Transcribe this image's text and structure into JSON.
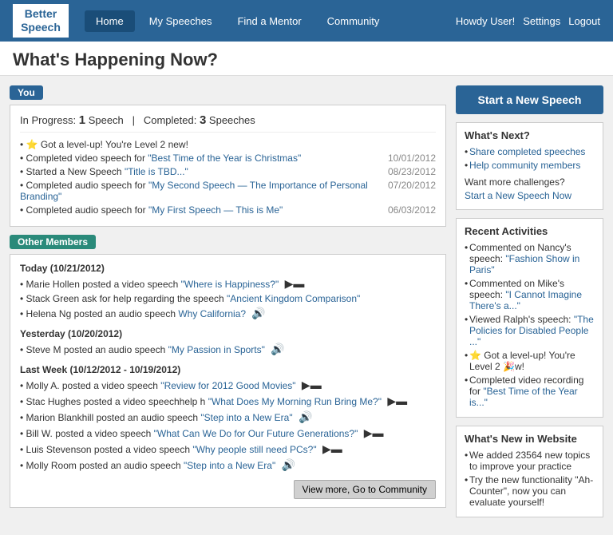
{
  "header": {
    "logo_line1": "Better",
    "logo_line2": "Speech",
    "nav_items": [
      {
        "label": "Home",
        "active": true
      },
      {
        "label": "My Speeches",
        "active": false
      },
      {
        "label": "Find a Mentor",
        "active": false
      },
      {
        "label": "Community",
        "active": false
      }
    ],
    "greeting": "Howdy User!",
    "settings_label": "Settings",
    "logout_label": "Logout"
  },
  "page": {
    "title": "What's Happening Now?",
    "start_button": "Start a New Speech"
  },
  "you_section": {
    "badge": "You",
    "in_progress_label": "In Progress:",
    "in_progress_count": "1",
    "in_progress_unit": "Speech",
    "separator": "|",
    "completed_label": "Completed:",
    "completed_count": "3",
    "completed_unit": "Speeches",
    "activities": [
      {
        "text": "⭐ Got a level-up! You're Level 2 new!",
        "link": null,
        "date": ""
      },
      {
        "prefix": "• Completed video speech for ",
        "link_text": "\"Best Time of the Year is Christmas\"",
        "link_href": "#",
        "date": "10/01/2012"
      },
      {
        "prefix": "• Started a New Speech ",
        "link_text": "\"Title is TBD...\"",
        "link_href": "#",
        "date": "08/23/2012"
      },
      {
        "prefix": "• Completed audio speech for ",
        "link_text": "\"My Second Speech — The Importance of Personal Branding\"",
        "link_href": "#",
        "date": "07/20/2012"
      },
      {
        "prefix": "• Completed audio speech for ",
        "link_text": "\"My First Speech — This is Me\"",
        "link_href": "#",
        "date": "06/03/2012"
      }
    ]
  },
  "other_section": {
    "badge": "Other Members",
    "days": [
      {
        "label": "Today (10/21/2012)",
        "items": [
          {
            "text": "• Marie Hollen posted a video speech ",
            "link_text": "\"Where is Happiness?\"",
            "link_href": "#",
            "icon": "video"
          },
          {
            "text": "• Stack Green ask for help regarding the speech ",
            "link_text": "\"Ancient Kingdom Comparison\"",
            "link_href": "#",
            "icon": null
          },
          {
            "text": "• Helena Ng posted an audio speech ",
            "link_text": "Why California?",
            "link_href": "#",
            "icon": "audio"
          }
        ]
      },
      {
        "label": "Yesterday (10/20/2012)",
        "items": [
          {
            "text": "• Steve M posted an audio speech ",
            "link_text": "\"My Passion in Sports\"",
            "link_href": "#",
            "icon": "audio"
          }
        ]
      },
      {
        "label": "Last Week (10/12/2012 - 10/19/2012)",
        "items": [
          {
            "text": "• Molly A. posted a video speech ",
            "link_text": "\"Review for 2012 Good Movies\"",
            "link_href": "#",
            "icon": "video"
          },
          {
            "text": "• Stac Hughes posted a video speechhelp h ",
            "link_text": "\"What Does My Morning Run Bring Me?\"",
            "link_href": "#",
            "icon": "video"
          },
          {
            "text": "• Marion Blankhill posted an audio speech ",
            "link_text": "\"Step into a New Era\"",
            "link_href": "#",
            "icon": "audio"
          },
          {
            "text": "• Bill W. posted a video speech ",
            "link_text": "\"What Can We Do for Our Future Generations?\"",
            "link_href": "#",
            "icon": "video"
          },
          {
            "text": "• Luis Stevenson posted a video speech ",
            "link_text": "\"Why people still need PCs?\"",
            "link_href": "#",
            "icon": "video"
          },
          {
            "text": "• Molly Room posted an audio speech ",
            "link_text": "\"Step into a New Era\"",
            "link_href": "#",
            "icon": "audio"
          }
        ]
      }
    ],
    "view_more_button": "View more, Go to Community"
  },
  "sidebar": {
    "whats_next": {
      "title": "What's Next?",
      "links": [
        {
          "text": "Share completed speeches",
          "href": "#"
        },
        {
          "text": "Help community members",
          "href": "#"
        }
      ],
      "want_more": "Want more challenges?",
      "start_link": "Start a New Speech Now",
      "start_href": "#"
    },
    "recent_activities": {
      "title": "Recent Activities",
      "items": [
        {
          "text": "Commented on Nancy's speech: ",
          "link": "\"Fashion Show in Paris\"",
          "href": "#"
        },
        {
          "text": "Commented on Mike's speech: ",
          "link": "\"I Cannot Imagine There's a...\"",
          "href": "#"
        },
        {
          "text": "Viewed Ralph's speech: ",
          "link": "\"The Policies for Disabled People ...\"",
          "href": "#"
        },
        {
          "text": "⭐ Got a level-up! You're Level 2 🎉w!",
          "link": null,
          "href": null
        },
        {
          "text": "Completed video recording for ",
          "link": "\"Best Time of the Year is...\"",
          "href": "#"
        }
      ]
    },
    "whats_new": {
      "title": "What's New in Website",
      "items": [
        "We added 23564 new topics to improve your practice",
        "Try the new functionality \"Ah-Counter\", now you can evaluate yourself!"
      ]
    }
  }
}
